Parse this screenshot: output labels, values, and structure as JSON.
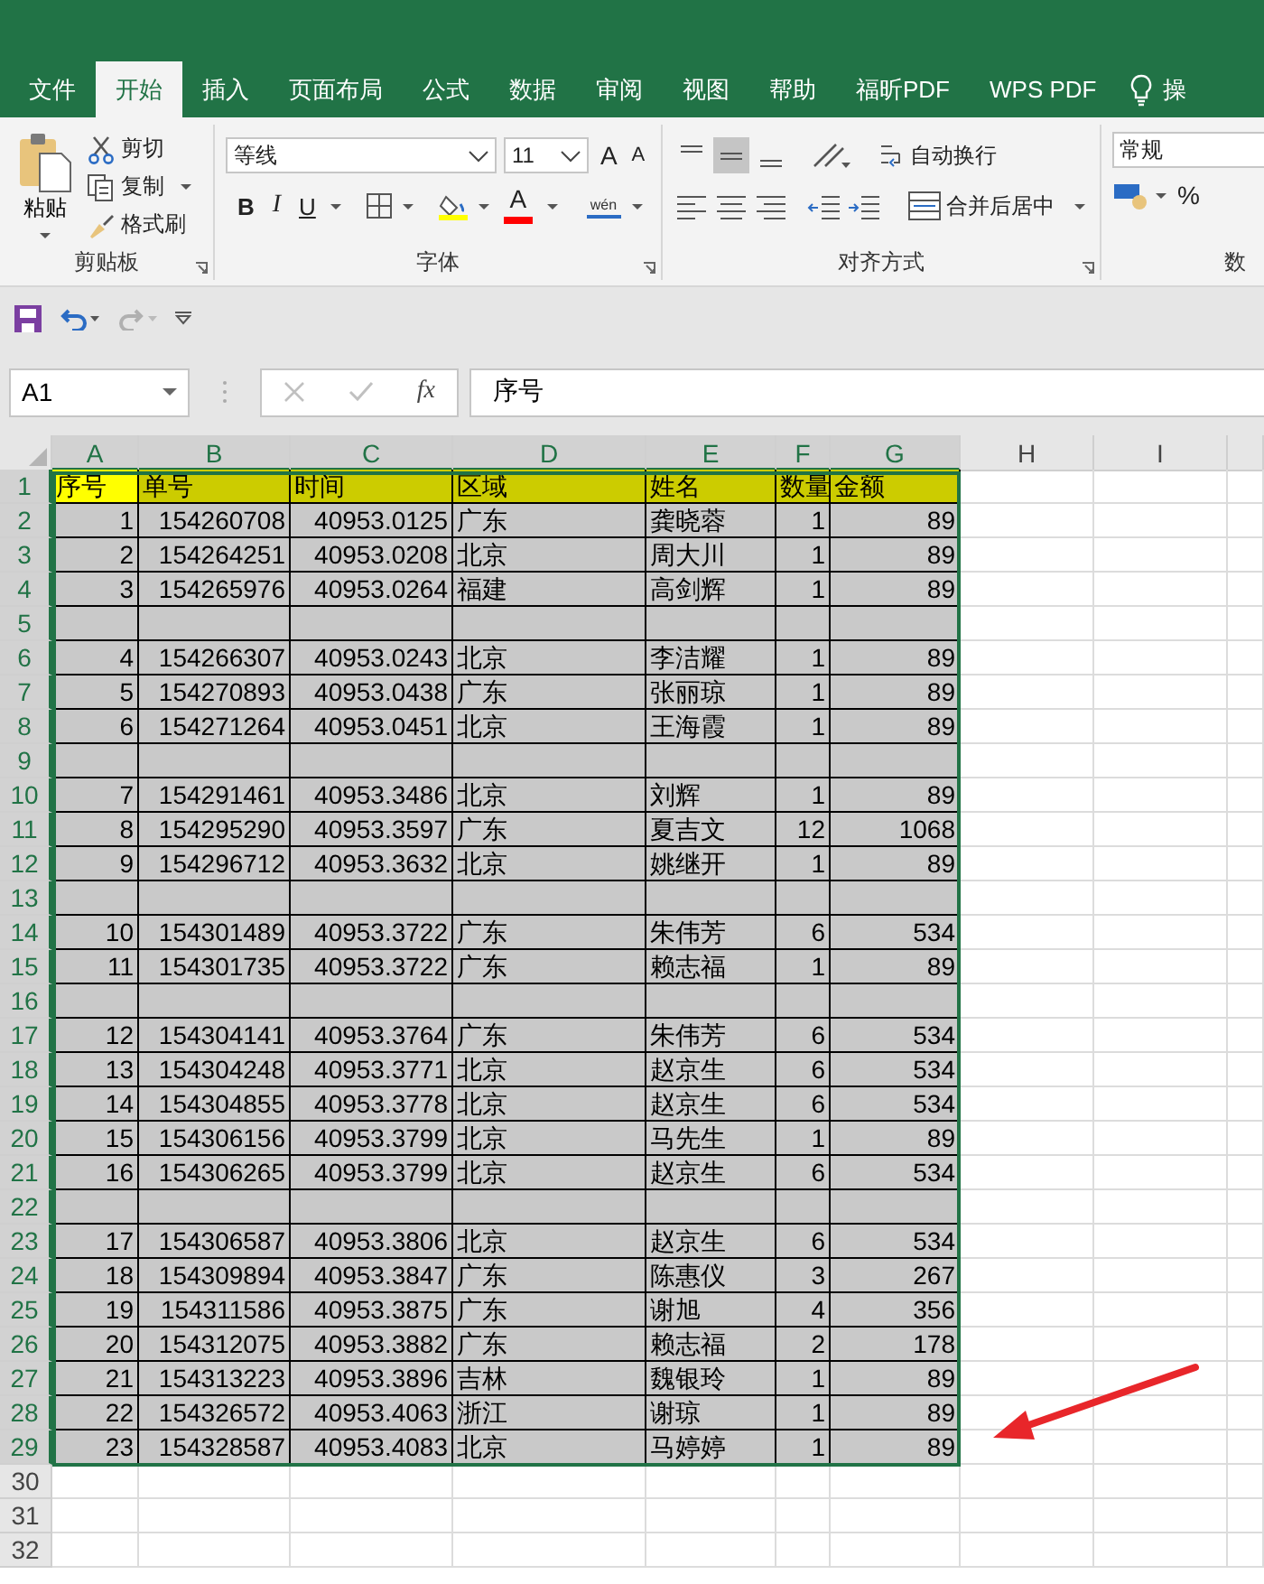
{
  "ribbon_tabs": [
    {
      "label": "文件",
      "selected": false
    },
    {
      "label": "开始",
      "selected": true
    },
    {
      "label": "插入",
      "selected": false
    },
    {
      "label": "页面布局",
      "selected": false
    },
    {
      "label": "公式",
      "selected": false
    },
    {
      "label": "数据",
      "selected": false
    },
    {
      "label": "审阅",
      "selected": false
    },
    {
      "label": "视图",
      "selected": false
    },
    {
      "label": "帮助",
      "selected": false
    },
    {
      "label": "福昕PDF",
      "selected": false
    },
    {
      "label": "WPS PDF",
      "selected": false
    }
  ],
  "tell_me": "操",
  "clipboard_group": {
    "title": "剪贴板",
    "paste": "粘贴",
    "cut": "剪切",
    "copy": "复制",
    "format_painter": "格式刷"
  },
  "font_group": {
    "title": "字体",
    "font_name": "等线",
    "font_size": "11",
    "grow": "A",
    "shrink": "A",
    "bold": "B",
    "italic": "I",
    "underline": "U",
    "font_color": "A",
    "phonetic": "wén"
  },
  "alignment_group": {
    "title": "对齐方式",
    "vertical_align": [
      {
        "selected": false
      },
      {
        "selected": true
      },
      {
        "selected": false
      }
    ],
    "wrap_text": "自动换行",
    "merge_center": "合并后居中"
  },
  "number_group": {
    "title": "数",
    "format": "常规",
    "percent": "%"
  },
  "quick_access": {
    "undo": {
      "disabled": false
    },
    "redo": {
      "disabled": true
    }
  },
  "formula_bar": {
    "name_box": "A1",
    "function": "fx",
    "value": "序号"
  },
  "sheet": {
    "columns": [
      {
        "label": "A",
        "selected": true
      },
      {
        "label": "B",
        "selected": true
      },
      {
        "label": "C",
        "selected": true
      },
      {
        "label": "D",
        "selected": true
      },
      {
        "label": "E",
        "selected": true
      },
      {
        "label": "F",
        "selected": true
      },
      {
        "label": "G",
        "selected": true
      },
      {
        "label": "H",
        "selected": false
      },
      {
        "label": "I",
        "selected": false
      }
    ],
    "rows": [
      {
        "number": "1",
        "selected": true,
        "kind": "header",
        "cells": [
          {
            "text": "序号",
            "active": true
          },
          {
            "text": "单号",
            "active": false
          },
          {
            "text": "时间",
            "active": false
          },
          {
            "text": "区域",
            "active": false
          },
          {
            "text": "姓名",
            "active": false
          },
          {
            "text": "数量",
            "active": false
          },
          {
            "text": "金额",
            "active": false
          }
        ]
      },
      {
        "number": "2",
        "selected": true,
        "kind": "data",
        "cells": [
          "1",
          "154260708",
          "40953.0125",
          "广东",
          "龚晓蓉",
          "1",
          "89"
        ]
      },
      {
        "number": "3",
        "selected": true,
        "kind": "data",
        "cells": [
          "2",
          "154264251",
          "40953.0208",
          "北京",
          "周大川",
          "1",
          "89"
        ]
      },
      {
        "number": "4",
        "selected": true,
        "kind": "data",
        "cells": [
          "3",
          "154265976",
          "40953.0264",
          "福建",
          "高剑辉",
          "1",
          "89"
        ]
      },
      {
        "number": "5",
        "selected": true,
        "kind": "blank"
      },
      {
        "number": "6",
        "selected": true,
        "kind": "data",
        "cells": [
          "4",
          "154266307",
          "40953.0243",
          "北京",
          "李洁耀",
          "1",
          "89"
        ]
      },
      {
        "number": "7",
        "selected": true,
        "kind": "data",
        "cells": [
          "5",
          "154270893",
          "40953.0438",
          "广东",
          "张丽琼",
          "1",
          "89"
        ]
      },
      {
        "number": "8",
        "selected": true,
        "kind": "data",
        "cells": [
          "6",
          "154271264",
          "40953.0451",
          "北京",
          "王海霞",
          "1",
          "89"
        ]
      },
      {
        "number": "9",
        "selected": true,
        "kind": "blank"
      },
      {
        "number": "10",
        "selected": true,
        "kind": "data",
        "cells": [
          "7",
          "154291461",
          "40953.3486",
          "北京",
          "刘辉",
          "1",
          "89"
        ]
      },
      {
        "number": "11",
        "selected": true,
        "kind": "data",
        "cells": [
          "8",
          "154295290",
          "40953.3597",
          "广东",
          "夏吉文",
          "12",
          "1068"
        ]
      },
      {
        "number": "12",
        "selected": true,
        "kind": "data",
        "cells": [
          "9",
          "154296712",
          "40953.3632",
          "北京",
          "姚继开",
          "1",
          "89"
        ]
      },
      {
        "number": "13",
        "selected": true,
        "kind": "blank"
      },
      {
        "number": "14",
        "selected": true,
        "kind": "data",
        "cells": [
          "10",
          "154301489",
          "40953.3722",
          "广东",
          "朱伟芳",
          "6",
          "534"
        ]
      },
      {
        "number": "15",
        "selected": true,
        "kind": "data",
        "cells": [
          "11",
          "154301735",
          "40953.3722",
          "广东",
          "赖志福",
          "1",
          "89"
        ]
      },
      {
        "number": "16",
        "selected": true,
        "kind": "blank"
      },
      {
        "number": "17",
        "selected": true,
        "kind": "data",
        "cells": [
          "12",
          "154304141",
          "40953.3764",
          "广东",
          "朱伟芳",
          "6",
          "534"
        ]
      },
      {
        "number": "18",
        "selected": true,
        "kind": "data",
        "cells": [
          "13",
          "154304248",
          "40953.3771",
          "北京",
          "赵京生",
          "6",
          "534"
        ]
      },
      {
        "number": "19",
        "selected": true,
        "kind": "data",
        "cells": [
          "14",
          "154304855",
          "40953.3778",
          "北京",
          "赵京生",
          "6",
          "534"
        ]
      },
      {
        "number": "20",
        "selected": true,
        "kind": "data",
        "cells": [
          "15",
          "154306156",
          "40953.3799",
          "北京",
          "马先生",
          "1",
          "89"
        ]
      },
      {
        "number": "21",
        "selected": true,
        "kind": "data",
        "cells": [
          "16",
          "154306265",
          "40953.3799",
          "北京",
          "赵京生",
          "6",
          "534"
        ]
      },
      {
        "number": "22",
        "selected": true,
        "kind": "blank"
      },
      {
        "number": "23",
        "selected": true,
        "kind": "data",
        "cells": [
          "17",
          "154306587",
          "40953.3806",
          "北京",
          "赵京生",
          "6",
          "534"
        ]
      },
      {
        "number": "24",
        "selected": true,
        "kind": "data",
        "cells": [
          "18",
          "154309894",
          "40953.3847",
          "广东",
          "陈惠仪",
          "3",
          "267"
        ]
      },
      {
        "number": "25",
        "selected": true,
        "kind": "data",
        "cells": [
          "19",
          "154311586",
          "40953.3875",
          "广东",
          "谢旭",
          "4",
          "356"
        ]
      },
      {
        "number": "26",
        "selected": true,
        "kind": "data",
        "cells": [
          "20",
          "154312075",
          "40953.3882",
          "广东",
          "赖志福",
          "2",
          "178"
        ]
      },
      {
        "number": "27",
        "selected": true,
        "kind": "data",
        "cells": [
          "21",
          "154313223",
          "40953.3896",
          "吉林",
          "魏银玲",
          "1",
          "89"
        ]
      },
      {
        "number": "28",
        "selected": true,
        "kind": "data",
        "cells": [
          "22",
          "154326572",
          "40953.4063",
          "浙江",
          "谢琼",
          "1",
          "89"
        ]
      },
      {
        "number": "29",
        "selected": true,
        "kind": "data",
        "cells": [
          "23",
          "154328587",
          "40953.4083",
          "北京",
          "马婷婷",
          "1",
          "89"
        ]
      },
      {
        "number": "30",
        "selected": false,
        "kind": "empty"
      },
      {
        "number": "31",
        "selected": false,
        "kind": "empty"
      },
      {
        "number": "32",
        "selected": false,
        "kind": "empty"
      }
    ]
  }
}
